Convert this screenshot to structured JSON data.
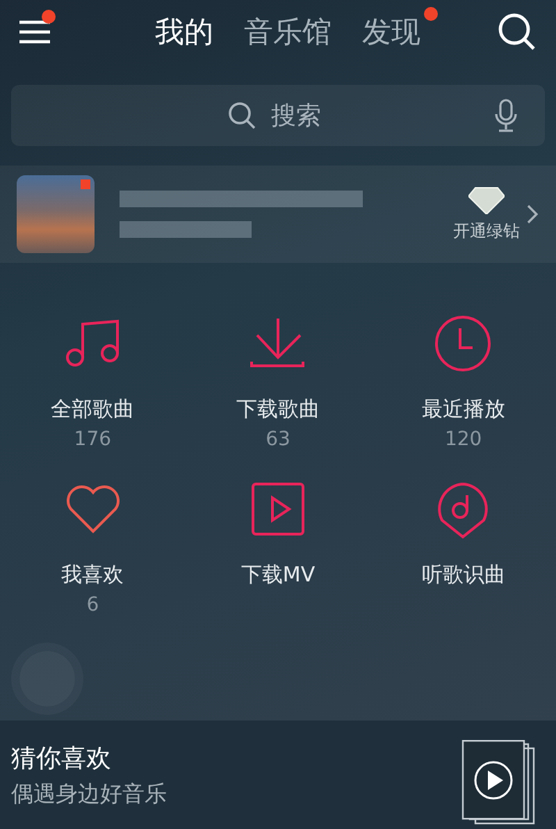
{
  "header": {
    "menu_badge": true,
    "tabs": [
      {
        "label": "我的",
        "selected": true,
        "badge": false
      },
      {
        "label": "音乐馆",
        "selected": false,
        "badge": false
      },
      {
        "label": "发现",
        "selected": false,
        "badge": true
      }
    ]
  },
  "search": {
    "placeholder": "搜索"
  },
  "profile": {
    "avatar_badge": true,
    "vip_label": "开通绿钻"
  },
  "shortcuts": [
    {
      "kind": "note",
      "label": "全部歌曲",
      "count": "176"
    },
    {
      "kind": "download",
      "label": "下载歌曲",
      "count": "63"
    },
    {
      "kind": "clock",
      "label": "最近播放",
      "count": "120"
    },
    {
      "kind": "heart",
      "label": "我喜欢",
      "count": "6"
    },
    {
      "kind": "video",
      "label": "下载MV"
    },
    {
      "kind": "recognize",
      "label": "听歌识曲"
    }
  ],
  "recommend": {
    "title": "猜你喜欢",
    "subtitle": "偶遇身边好音乐"
  }
}
